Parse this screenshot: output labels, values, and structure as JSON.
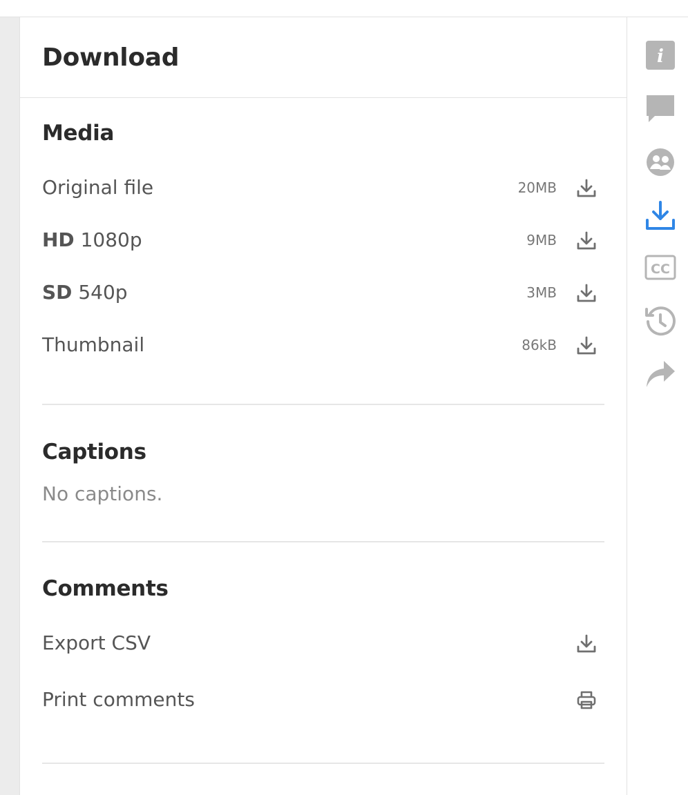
{
  "panel": {
    "title": "Download"
  },
  "media": {
    "title": "Media",
    "items": [
      {
        "prefix": "",
        "label": "Original file",
        "size": "20MB",
        "icon": "download-icon"
      },
      {
        "prefix": "HD",
        "label": " 1080p",
        "size": "9MB",
        "icon": "download-icon"
      },
      {
        "prefix": "SD",
        "label": " 540p",
        "size": "3MB",
        "icon": "download-icon"
      },
      {
        "prefix": "",
        "label": "Thumbnail",
        "size": "86kB",
        "icon": "download-icon"
      }
    ]
  },
  "captions": {
    "title": "Captions",
    "empty_text": "No captions."
  },
  "comments": {
    "title": "Comments",
    "items": [
      {
        "label": "Export CSV",
        "icon": "download-icon"
      },
      {
        "label": "Print comments",
        "icon": "printer-icon"
      }
    ]
  },
  "sidebar": {
    "active": "download",
    "items": [
      {
        "id": "info",
        "icon": "info-icon"
      },
      {
        "id": "comments",
        "icon": "comment-icon"
      },
      {
        "id": "people",
        "icon": "people-icon"
      },
      {
        "id": "download",
        "icon": "download-icon"
      },
      {
        "id": "captions",
        "icon": "closed-captions-icon"
      },
      {
        "id": "history",
        "icon": "history-icon"
      },
      {
        "id": "share",
        "icon": "share-icon"
      }
    ]
  },
  "colors": {
    "accent": "#2f86e6",
    "icon_muted": "#b5b5b5",
    "text_dark": "#2b2b2b",
    "text_body": "#555555",
    "divider": "#e6e6e6"
  }
}
